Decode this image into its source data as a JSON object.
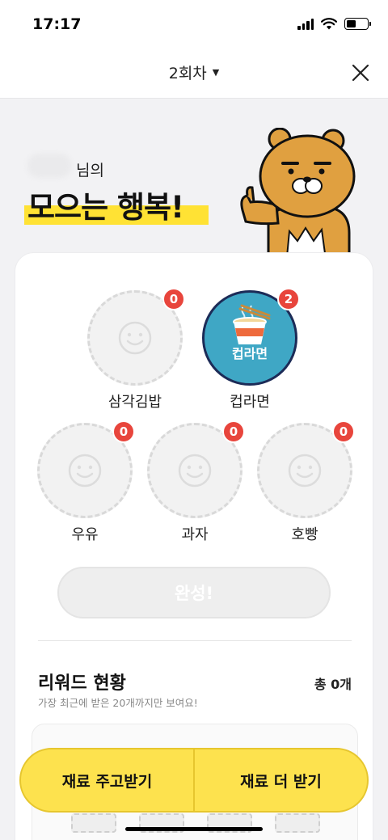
{
  "status_bar": {
    "time": "17:17"
  },
  "nav": {
    "round_label": "2회차",
    "caret": "▼"
  },
  "hero": {
    "nickname_suffix": "님의",
    "headline": "모으는 행복!"
  },
  "items": [
    {
      "label": "삼각김밥",
      "count": "0",
      "filled": false
    },
    {
      "label": "컵라면",
      "count": "2",
      "filled": true,
      "caption": "컵라면"
    },
    {
      "label": "우유",
      "count": "0",
      "filled": false
    },
    {
      "label": "과자",
      "count": "0",
      "filled": false
    },
    {
      "label": "호빵",
      "count": "0",
      "filled": false
    }
  ],
  "complete_button": "완성!",
  "rewards": {
    "title": "리워드 현황",
    "total": "총 0개",
    "subtitle": "가장 최근에 받은 20개까지만 보여요!"
  },
  "actions": {
    "give_receive": "재료 주고받기",
    "get_more": "재료 더 받기"
  },
  "colors": {
    "accent_yellow": "#fde24e",
    "badge_red": "#e8453c",
    "cup_blue": "#3fa7c5"
  }
}
